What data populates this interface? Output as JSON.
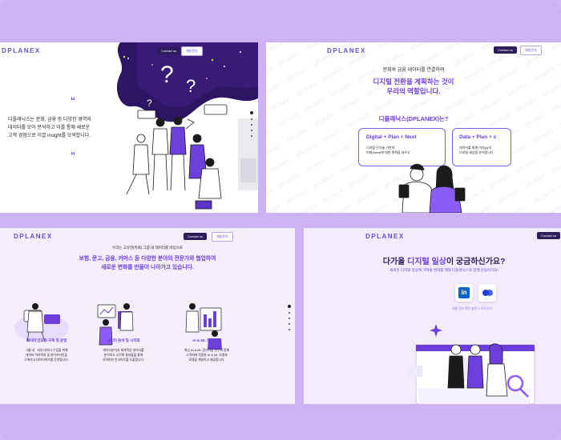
{
  "logo": "DPLANEX",
  "nav": {
    "contact_label": "Contact us",
    "recruit_label": "채용문의"
  },
  "panel1": {
    "quote_open": "“",
    "quote_close": "”",
    "intro_line1": "디플래닉스는 문화, 금융 등 다양한 영역의",
    "intro_line2": "데이터를 모아 분석하고 이를 통해 새로운",
    "intro_line3": "고객 경험으로 이끌 insight를 모색합니다."
  },
  "panel2": {
    "kicker": "문화와 금융 데이터를 연결하여",
    "headline_line1": "디지털 전환을 계획하는 것이",
    "headline_line2": "우리의 역할입니다.",
    "question": "디플래닉스(DPLANEX)는?",
    "card_left_title": "Digital + Plan + Next",
    "card_left_line1": "디지털 신기술 기반의",
    "card_left_line2": "미래(Next)에 대한 계획을 세우고,",
    "card_right_title": "Data + Plan + x",
    "card_right_line1": "데이터를 통해 미지(x)의",
    "card_right_line2": "디지털 세상을 분석합니다."
  },
  "panel3": {
    "kicker": "우리는 고유한(특화) 그룹 내 데이터를 바탕으로",
    "headline_line1": "보험, 문고, 금융, 커머스 등 다양한 분야의 전문가와 협업하여",
    "headline_line2": "새로운 변화를 만들어 나아가고 있습니다.",
    "features": [
      {
        "title": "데이터 인프라 구축 및 운영",
        "line1": "그룹 내 · 외부 데이터 수집을 위해",
        "line2": "데이터 아키텍처 및 파이프라인을",
        "line3": "구축하고 데이터허브를 운영합니다."
      },
      {
        "title": "데이터 분석 및 시각화",
        "line1": "데이터분석과 체계적인 데이터를",
        "line2": "분석하고 시각화 결과물을 통해",
        "line3": "유의미한 인사이트를 도출합니다."
      },
      {
        "title": "AI & ML 모델 개발",
        "line1": "최신 AI & ML 알고리즘 연구와 함께",
        "line2": "고객에게 적합한 AI & ML 모델과",
        "line3": "모델을 개발하고 제공합니다."
      }
    ]
  },
  "panel4": {
    "headline_plain1": "다가올 ",
    "headline_accent": "디지털 일상",
    "headline_plain2": "이 궁금하신가요?",
    "subtitle": "새로운 디지털 일상에 가져올 변화를 제외 디플래닉스와 함께 만들어가요!",
    "social_linkedin": "in",
    "social_note": "채용 정보 확인 블로그 바로가기"
  },
  "colors": {
    "accent": "#6c3fdc",
    "dark": "#2d1d5a",
    "background": "#cdb2f4"
  }
}
